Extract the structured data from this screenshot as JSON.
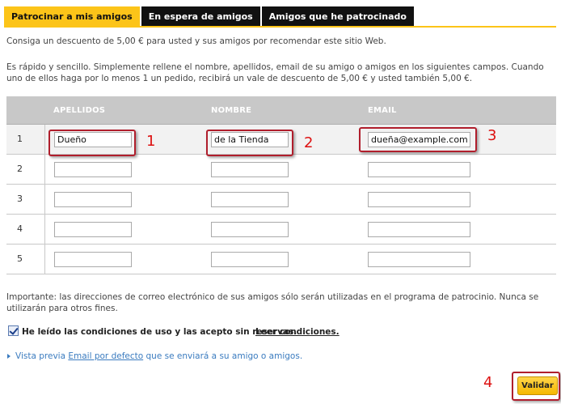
{
  "tabs": [
    {
      "label": "Patrocinar a mis amigos",
      "active": true
    },
    {
      "label": "En espera de amigos",
      "active": false
    },
    {
      "label": "Amigos que he patrocinado",
      "active": false
    }
  ],
  "intro": "Consiga un descuento de 5,00 € para usted y sus amigos por recomendar este sitio Web.",
  "instructions": "Es rápido y sencillo. Simplemente rellene el nombre, apellidos, email de su amigo o amigos en los siguientes campos. Cuando uno de ellos haga por lo menos 1 un pedido, recibirá un vale de descuento de 5,00 € y usted también 5,00 €.",
  "table": {
    "headers": {
      "apellidos": "APELLIDOS",
      "nombre": "NOMBRE",
      "email": "EMAIL"
    },
    "rows": [
      {
        "num": "1",
        "apellidos": "Dueño",
        "nombre": "de la Tienda",
        "email": "dueña@example.com"
      },
      {
        "num": "2",
        "apellidos": "",
        "nombre": "",
        "email": ""
      },
      {
        "num": "3",
        "apellidos": "",
        "nombre": "",
        "email": ""
      },
      {
        "num": "4",
        "apellidos": "",
        "nombre": "",
        "email": ""
      },
      {
        "num": "5",
        "apellidos": "",
        "nombre": "",
        "email": ""
      }
    ]
  },
  "annotations": [
    "1",
    "2",
    "3",
    "4"
  ],
  "important": "Importante: las direcciones de correo electrónico de sus amigos sólo serán utilizadas en el programa de patrocinio. Nunca se utilizarán para otros fines.",
  "conditions": {
    "text": "He leído las condiciones de uso y las acepto sin reservas.",
    "link": "Leer condiciones.",
    "checked": true
  },
  "preview": {
    "before": "Vista previa",
    "link": "Email por defecto",
    "after": "que se enviará a su amigo o amigos."
  },
  "submit_label": "Validar",
  "colors": {
    "accent": "#fcc419",
    "tab_dark": "#111111",
    "annotation": "#b01e2c",
    "link": "#3a7bbf"
  }
}
